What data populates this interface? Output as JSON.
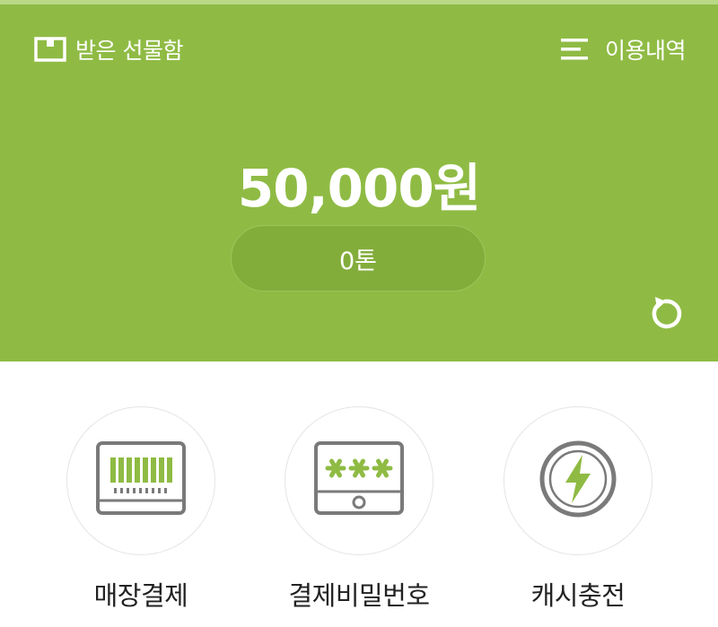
{
  "colors": {
    "brand_green": "#8fbb44",
    "pill_green": "#83ad3b",
    "icon_gray": "#7a7a7a",
    "icon_green": "#8fbb44"
  },
  "header": {
    "gift_box": {
      "label": "받은 선물함",
      "icon": "gift-box-icon"
    },
    "history": {
      "label": "이용내역",
      "icon": "list-menu-icon"
    },
    "balance": "50,000원",
    "points": "0톤",
    "refresh_icon": "refresh-icon"
  },
  "menu": [
    {
      "label": "매장결제",
      "icon": "barcode-payment-icon"
    },
    {
      "label": "결제비밀번호",
      "icon": "password-keypad-icon"
    },
    {
      "label": "캐시충전",
      "icon": "lightning-charge-icon"
    }
  ]
}
